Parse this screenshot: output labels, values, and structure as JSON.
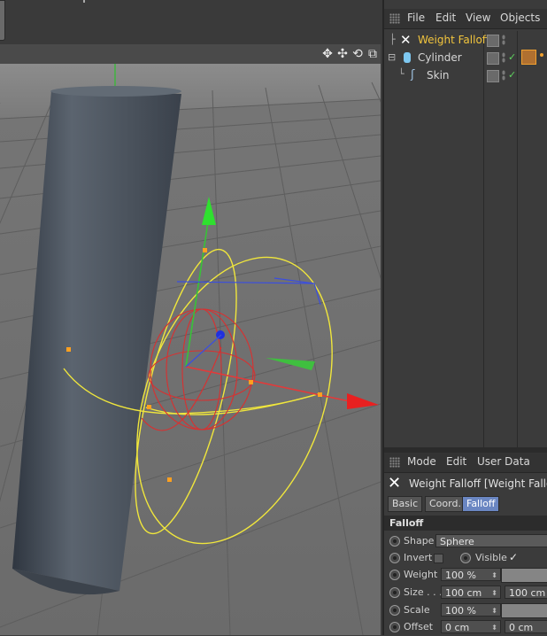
{
  "object_manager": {
    "menu": [
      "File",
      "Edit",
      "View",
      "Objects"
    ],
    "objects": [
      {
        "name": "Weight Falloff",
        "color": "#f2c53d"
      },
      {
        "name": "Cylinder",
        "color": "#d6d6d6"
      },
      {
        "name": "Skin",
        "color": "#d6d6d6"
      }
    ]
  },
  "attributes": {
    "menu": [
      "Mode",
      "Edit",
      "User Data"
    ],
    "title": "Weight Falloff [Weight Falloff]",
    "tabs": [
      "Basic",
      "Coord.",
      "Falloff"
    ],
    "active_tab": "Falloff",
    "section": "Falloff",
    "params": {
      "shape_label": "Shape",
      "shape_value": "Sphere",
      "invert_label": "Invert",
      "visible_label": "Visible",
      "visible_check": "✓",
      "weight_label": "Weight",
      "weight_value": "100 %",
      "size_label": "Size . . .",
      "size_x": "100 cm",
      "size_y": "100 cm",
      "scale_label": "Scale",
      "scale_value": "100 %",
      "offset_label": "Offset",
      "offset_x": "0 cm",
      "offset_y": "0 cm"
    }
  },
  "colors": {
    "accent": "#6a86c2",
    "selected_object": "#f2c53d",
    "falloff_gizmo": "#f0e63c"
  }
}
